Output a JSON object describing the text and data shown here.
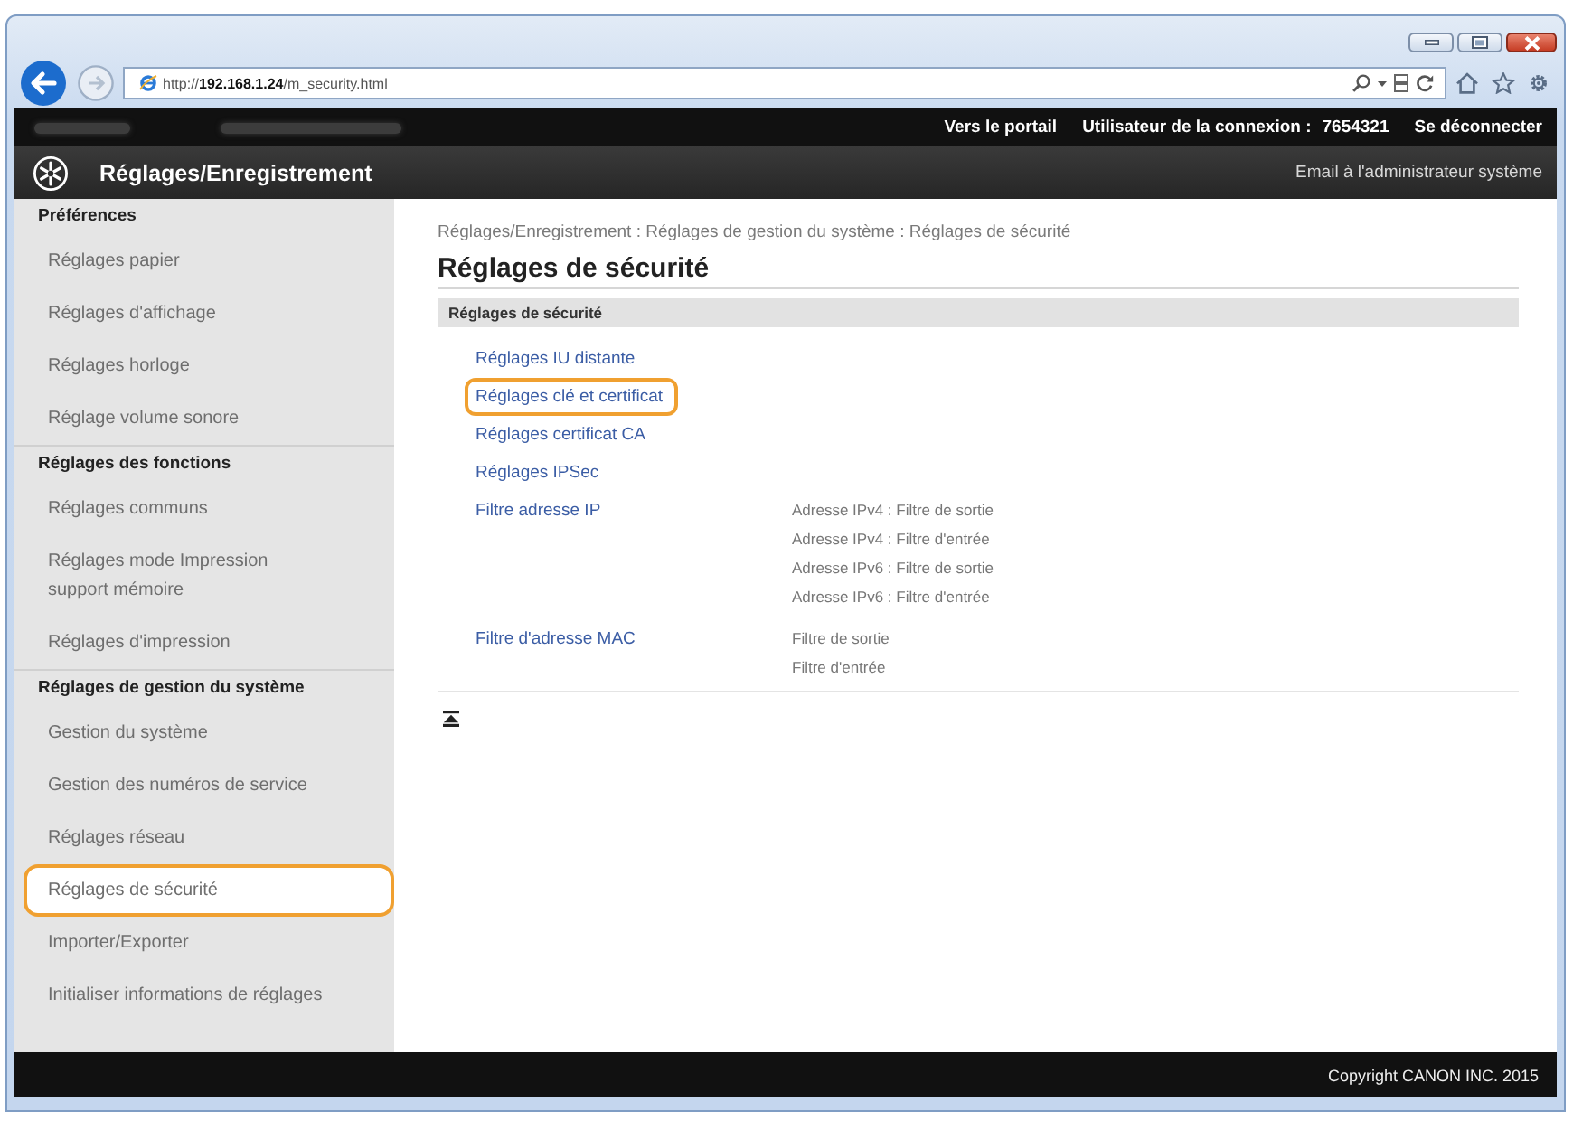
{
  "browser": {
    "url": "http://**192.168.1.24**/m_security.html"
  },
  "top_bar": {
    "portal_link": "Vers le portail",
    "user_label": "Utilisateur de la connexion :",
    "user_id": "7654321",
    "logout_link": "Se déconnecter"
  },
  "header": {
    "title": "Réglages/Enregistrement",
    "admin_link": "Email à l'administrateur système"
  },
  "sidebar": {
    "groups": [
      {
        "heading": "Préférences",
        "items": [
          {
            "label": "Réglages papier",
            "highlighted": false
          },
          {
            "label": "Réglages d'affichage",
            "highlighted": false
          },
          {
            "label": "Réglages horloge",
            "highlighted": false
          },
          {
            "label": "Réglage volume sonore",
            "highlighted": false
          }
        ]
      },
      {
        "heading": "Réglages des fonctions",
        "items": [
          {
            "label": "Réglages communs",
            "highlighted": false
          },
          {
            "label": "Réglages mode Impression\nsupport mémoire",
            "highlighted": false
          },
          {
            "label": "Réglages d'impression",
            "highlighted": false
          }
        ]
      },
      {
        "heading": "Réglages de gestion du système",
        "items": [
          {
            "label": "Gestion du système",
            "highlighted": false
          },
          {
            "label": "Gestion des numéros de service",
            "highlighted": false
          },
          {
            "label": "Réglages réseau",
            "highlighted": false
          },
          {
            "label": "Réglages de sécurité",
            "highlighted": true
          },
          {
            "label": "Importer/Exporter",
            "highlighted": false
          },
          {
            "label": "Initialiser informations de réglages",
            "highlighted": false
          }
        ]
      }
    ]
  },
  "content": {
    "breadcrumb": "Réglages/Enregistrement : Réglages de gestion du système : Réglages de sécurité",
    "title": "Réglages de sécurité",
    "section": {
      "heading": "Réglages de sécurité",
      "links": [
        {
          "label": "Réglages IU distante",
          "highlighted": false
        },
        {
          "label": "Réglages clé et certificat",
          "highlighted": true
        },
        {
          "label": "Réglages certificat CA",
          "highlighted": false
        },
        {
          "label": "Réglages IPSec",
          "highlighted": false
        },
        {
          "label": "Filtre adresse IP",
          "highlighted": false,
          "details": [
            "Adresse IPv4 : Filtre de sortie",
            "Adresse IPv4 : Filtre d'entrée",
            "Adresse IPv6 : Filtre de sortie",
            "Adresse IPv6 : Filtre d'entrée"
          ]
        },
        {
          "label": "Filtre d'adresse MAC",
          "highlighted": false,
          "details": [
            "Filtre de sortie",
            "Filtre d'entrée"
          ]
        }
      ]
    }
  },
  "footer": {
    "copyright": "Copyright CANON INC. 2015"
  }
}
